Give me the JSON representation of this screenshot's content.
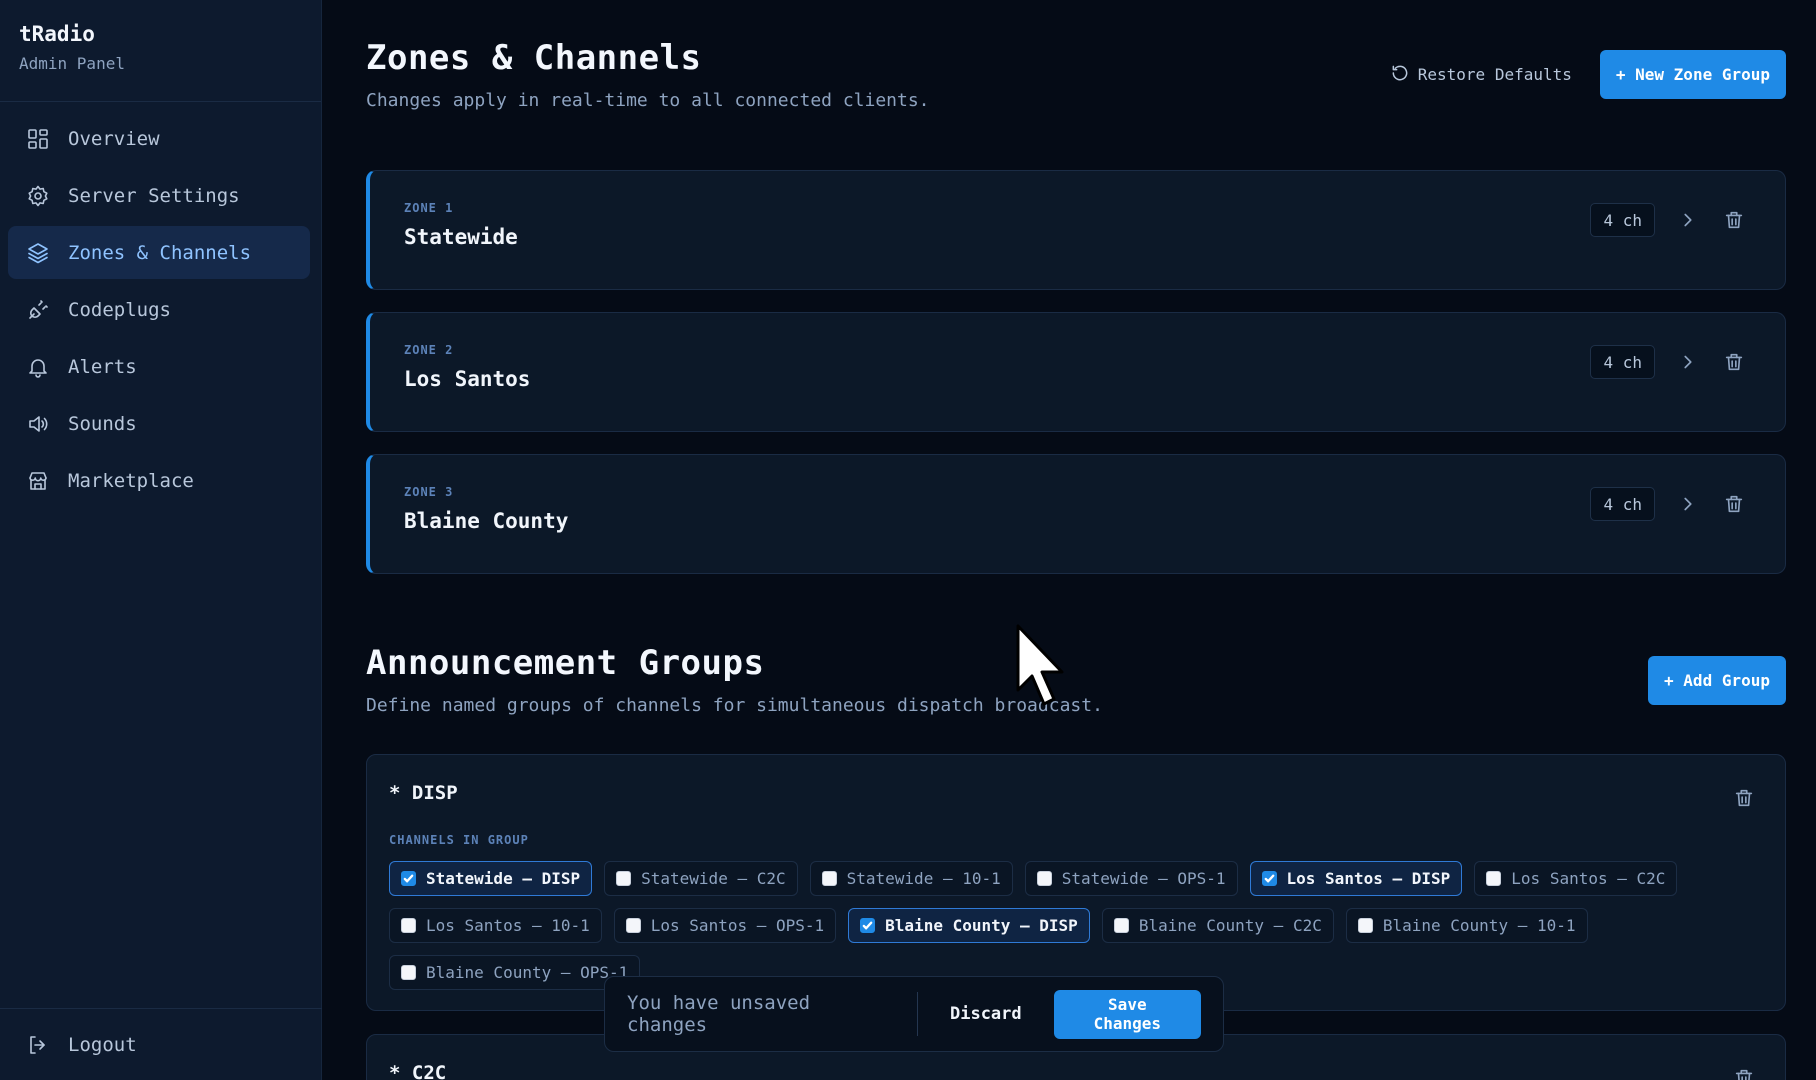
{
  "sidebar": {
    "brand_title": "tRadio",
    "brand_sub": "Admin Panel",
    "items": [
      {
        "label": "Overview",
        "icon": "grid-icon"
      },
      {
        "label": "Server Settings",
        "icon": "gear-icon"
      },
      {
        "label": "Zones & Channels",
        "icon": "layers-icon",
        "active": true
      },
      {
        "label": "Codeplugs",
        "icon": "plug-icon"
      },
      {
        "label": "Alerts",
        "icon": "bell-icon"
      },
      {
        "label": "Sounds",
        "icon": "speaker-icon"
      },
      {
        "label": "Marketplace",
        "icon": "store-icon"
      }
    ],
    "logout_label": "Logout"
  },
  "header": {
    "title": "Zones & Channels",
    "subtitle": "Changes apply in real-time to all connected clients.",
    "restore_label": "Restore Defaults",
    "new_zone_label": "+ New Zone Group"
  },
  "zones": [
    {
      "label": "ZONE 1",
      "name": "Statewide",
      "count": "4 ch"
    },
    {
      "label": "ZONE 2",
      "name": "Los Santos",
      "count": "4 ch"
    },
    {
      "label": "ZONE 3",
      "name": "Blaine County",
      "count": "4 ch"
    }
  ],
  "announcements": {
    "title": "Announcement Groups",
    "subtitle": "Define named groups of channels for simultaneous dispatch broadcast.",
    "add_label": "+ Add Group",
    "groups": [
      {
        "name": "* DISP",
        "channels_label": "CHANNELS IN GROUP",
        "channels": [
          {
            "label": "Statewide – DISP",
            "checked": true
          },
          {
            "label": "Statewide – C2C",
            "checked": false
          },
          {
            "label": "Statewide – 10-1",
            "checked": false
          },
          {
            "label": "Statewide – OPS-1",
            "checked": false
          },
          {
            "label": "Los Santos – DISP",
            "checked": true
          },
          {
            "label": "Los Santos – C2C",
            "checked": false
          },
          {
            "label": "Los Santos – 10-1",
            "checked": false
          },
          {
            "label": "Los Santos – OPS-1",
            "checked": false
          },
          {
            "label": "Blaine County – DISP",
            "checked": true
          },
          {
            "label": "Blaine County – C2C",
            "checked": false
          },
          {
            "label": "Blaine County – 10-1",
            "checked": false
          },
          {
            "label": "Blaine County – OPS-1",
            "checked": false
          }
        ]
      },
      {
        "name": "* C2C"
      }
    ]
  },
  "unsaved_bar": {
    "message": "You have unsaved changes",
    "discard_label": "Discard",
    "save_label": "Save Changes"
  },
  "colors": {
    "accent": "#1f8ae6",
    "background": "#050b16",
    "sidebar": "#0d1a2e"
  }
}
